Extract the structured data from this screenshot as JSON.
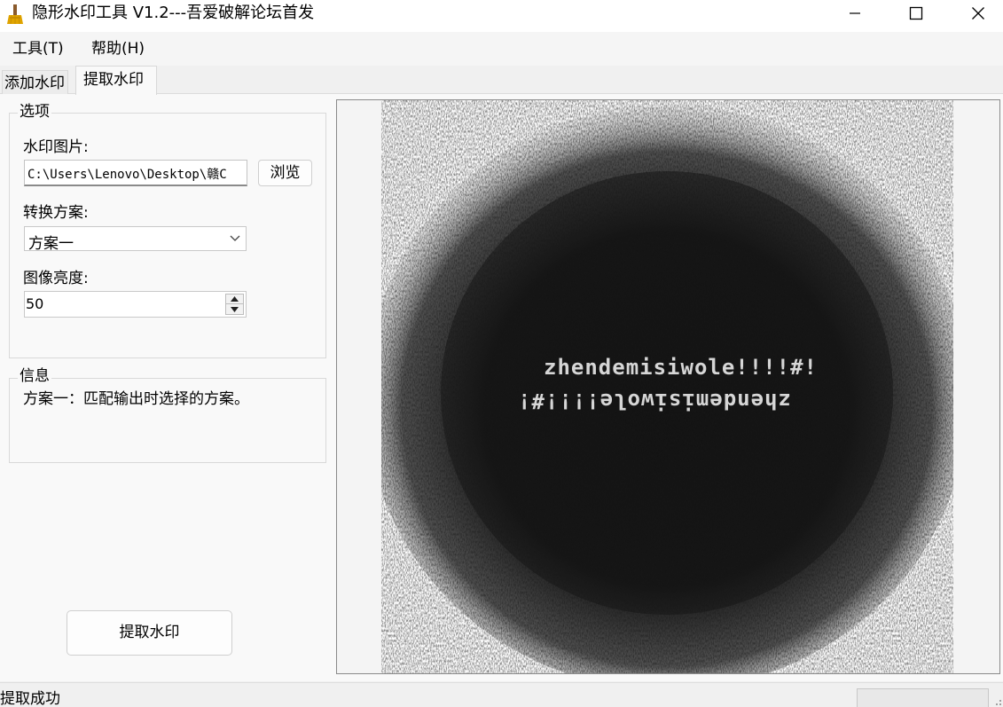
{
  "window": {
    "title": "隐形水印工具 V1.2---吾爱破解论坛首发",
    "icon": "broom-icon",
    "controls": [
      "minimize-icon",
      "maximize-icon",
      "close-icon"
    ]
  },
  "menu": {
    "tools": "工具(T)",
    "help": "帮助(H)"
  },
  "tabs": {
    "add": "添加水印",
    "extract": "提取水印",
    "active": "提取水印"
  },
  "options": {
    "legend": "选项",
    "watermark_label": "水印图片:",
    "watermark_path": "C:\\Users\\Lenovo\\Desktop\\赣C",
    "browse_label": "浏览",
    "scheme_label": "转换方案:",
    "scheme_value": "方案一",
    "brightness_label": "图像亮度:",
    "brightness_value": "50"
  },
  "info": {
    "legend": "信息",
    "text": "方案一：匹配输出时选择的方案。"
  },
  "action": {
    "extract_button": "提取水印"
  },
  "preview": {
    "line1": "zhendemisiwole!!!!#!",
    "line2": "zhendemisiwole!!!!#!"
  },
  "status": {
    "text": "提取成功",
    "progress": 0
  },
  "colors": {
    "titlebar": "#ffffff",
    "panel": "#f9f9f9",
    "noise_dark": "#1a1a1a",
    "watermark_text": "#d6d6d6"
  }
}
